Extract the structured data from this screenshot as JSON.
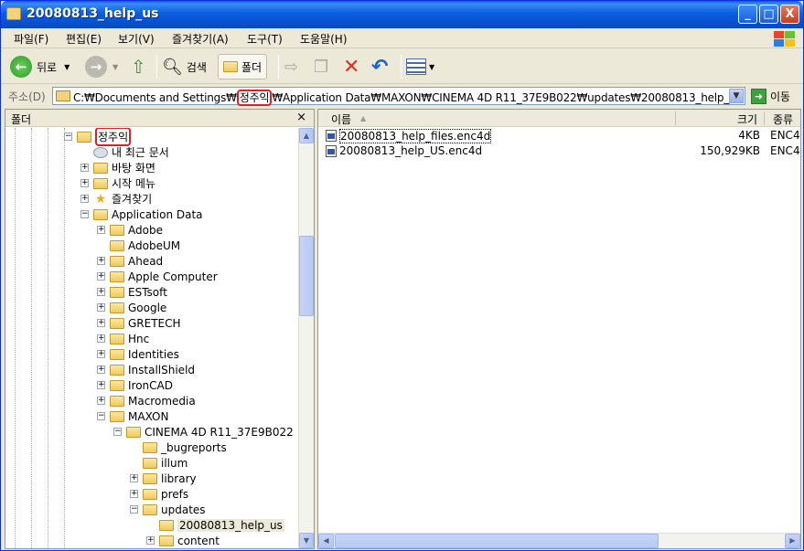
{
  "window": {
    "title": "20080813_help_us",
    "min_glyph": "_",
    "max_glyph": "□",
    "close_glyph": "X"
  },
  "menu": [
    "파일(F)",
    "편집(E)",
    "보기(V)",
    "즐겨찾기(A)",
    "도구(T)",
    "도움말(H)"
  ],
  "toolbar": {
    "back_label": "뒤로",
    "search_label": "검색",
    "folders_label": "폴더"
  },
  "address": {
    "label": "주소(D)",
    "path_prefix": "C:₩Documents and Settings₩",
    "path_highlight": "정주익",
    "path_suffix": "₩Application Data₩MAXON₩CINEMA 4D R11_37E9B022₩updates₩20080813_help_us",
    "go_label": "이동"
  },
  "folder_pane": {
    "title": "폴더",
    "close_glyph": "×",
    "tree": [
      {
        "label": "정주익",
        "icon": "folder-open-icon",
        "highlight": true
      },
      {
        "label": "내 최근 문서",
        "icon": "recent-docs-icon"
      },
      {
        "label": "바탕 화면",
        "icon": "folder-icon"
      },
      {
        "label": "시작 메뉴",
        "icon": "folder-icon"
      },
      {
        "label": "즐겨찾기",
        "icon": "favorites-star-icon"
      },
      {
        "label": "Application Data",
        "icon": "folder-open-icon"
      },
      {
        "label": "Adobe",
        "icon": "folder-icon"
      },
      {
        "label": "AdobeUM",
        "icon": "folder-icon"
      },
      {
        "label": "Ahead",
        "icon": "folder-icon"
      },
      {
        "label": "Apple Computer",
        "icon": "folder-icon"
      },
      {
        "label": "ESTsoft",
        "icon": "folder-icon"
      },
      {
        "label": "Google",
        "icon": "folder-icon"
      },
      {
        "label": "GRETECH",
        "icon": "folder-icon"
      },
      {
        "label": "Hnc",
        "icon": "folder-icon"
      },
      {
        "label": "Identities",
        "icon": "folder-icon"
      },
      {
        "label": "InstallShield",
        "icon": "folder-icon"
      },
      {
        "label": "IronCAD",
        "icon": "folder-icon"
      },
      {
        "label": "Macromedia",
        "icon": "folder-icon"
      },
      {
        "label": "MAXON",
        "icon": "folder-open-icon"
      },
      {
        "label": "CINEMA 4D R11_37E9B022",
        "icon": "folder-open-icon"
      },
      {
        "label": "_bugreports",
        "icon": "folder-icon"
      },
      {
        "label": "illum",
        "icon": "folder-icon"
      },
      {
        "label": "library",
        "icon": "folder-icon"
      },
      {
        "label": "prefs",
        "icon": "folder-icon"
      },
      {
        "label": "updates",
        "icon": "folder-open-icon"
      },
      {
        "label": "20080813_help_us",
        "icon": "folder-open-icon",
        "selected": true
      },
      {
        "label": "content",
        "icon": "folder-icon"
      }
    ]
  },
  "file_list": {
    "columns": {
      "name": "이름",
      "size": "크기",
      "type": "종류"
    },
    "files": [
      {
        "name": "20080813_help_files.enc4d",
        "size": "4KB",
        "type": "ENC4"
      },
      {
        "name": "20080813_help_US.enc4d",
        "size": "150,929KB",
        "type": "ENC4"
      }
    ]
  }
}
